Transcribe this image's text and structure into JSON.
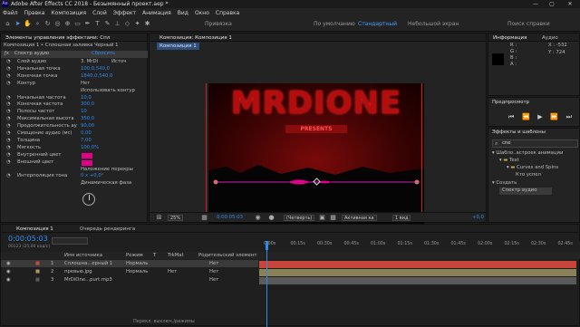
{
  "window": {
    "title": "Adobe After Effects CC 2018 - Безымянный проект.aep *",
    "app_icon": "Ae",
    "min": "—",
    "max": "▢",
    "close": "✕"
  },
  "menu": [
    "Файл",
    "Правка",
    "Композиция",
    "Слой",
    "Эффект",
    "Анимация",
    "Вид",
    "Окно",
    "Справка"
  ],
  "toolbar": {
    "snap": "Привязка",
    "ws_default": "По умолчанию",
    "ws_std": "Стандартный",
    "ws_small": "Небольшой экран",
    "search": "Поиск справки"
  },
  "effects_panel": {
    "tab_label": "Элементы управления эффектами: Спл",
    "layer_path": "Композиция 1 • Сплошная заливка Черный 1",
    "effect_name": "Спектр аудио",
    "reset": "Сбросить",
    "rows": [
      {
        "label": "Слой аудио",
        "value": "3. MrDi",
        "value2": "Источ"
      },
      {
        "label": "Начальная точка",
        "value": "100,0,540,0"
      },
      {
        "label": "Конечная точка",
        "value": "1840,0,540,0"
      },
      {
        "label": "Контур",
        "value": "Нет"
      },
      {
        "label": "",
        "value": "Использовать контур"
      },
      {
        "label": "Начальная частота",
        "value": "10,0"
      },
      {
        "label": "Конечная частота",
        "value": "300,0"
      },
      {
        "label": "Полосы частот",
        "value": "10"
      },
      {
        "label": "Максимальная высота",
        "value": "350,0"
      },
      {
        "label": "Продолжительность ау",
        "value": "90,00"
      },
      {
        "label": "Смещение аудио (мс)",
        "value": "0,00"
      },
      {
        "label": "Толщина",
        "value": "7,00"
      },
      {
        "label": "Мягкость",
        "value": "100,0%"
      },
      {
        "label": "Внутренний цвет",
        "value": ""
      },
      {
        "label": "Внешний цвет",
        "value": ""
      },
      {
        "label": "",
        "value": "Наложение перекры"
      },
      {
        "label": "Интерполяция тона",
        "value": "0 x +0,0°"
      },
      {
        "label": "",
        "value": "Динамическая фаза"
      }
    ]
  },
  "comp_panel": {
    "tab": "Композиция: Композиция 1",
    "subtab": "Композиция 1",
    "zoom": "25%",
    "time": "0:00:05:03",
    "quality": "(Четверть)",
    "camera": "Активная ка",
    "views": "1 вид",
    "offset": "+0,0"
  },
  "preview_text": {
    "title": "MRDIONE",
    "subtitle": "PRESENTS"
  },
  "info_panel": {
    "tab": "Информация",
    "tab2": "Аудио",
    "r": "R :",
    "g": "G :",
    "b": "B :",
    "a": "A :",
    "x": "X : -532",
    "y": "Y : 724"
  },
  "preview_panel": {
    "tab": "Предпросмотр"
  },
  "fx_presets": {
    "tab": "Эффекты и шаблоны",
    "search": "спе",
    "items": [
      "Шабло..астроек анимации",
      "Text",
      "Curves and Spins",
      "Кто успел",
      "Создать",
      "Спектр аудио"
    ]
  },
  "timeline": {
    "tab": "Композиция 1",
    "tab2": "Очередь рендеринга",
    "time": "0:00:05:03",
    "time_sub": "00123 (25,00 кад/с)",
    "headers": {
      "name": "Имя источника",
      "mode": "Режим",
      "t": "T",
      "trkmat": "TrkMat",
      "parent": "Родительский элемент"
    },
    "ticks": [
      "0:00s",
      "00:15s",
      "00:30s",
      "00:45s",
      "01:00s",
      "01:15s",
      "01:30s",
      "01:45s",
      "02:00s",
      "02:15s",
      "02:30s",
      "02:45s"
    ],
    "layers": [
      {
        "num": "1",
        "name": "Сплошна...ерный 1",
        "mode": "Нормаль",
        "trk": "",
        "parent": "Нет",
        "color": "#c8453c"
      },
      {
        "num": "2",
        "name": "превью.jpg",
        "mode": "Нормаль",
        "trk": "Нет",
        "parent": "Нет",
        "color": "#a89a62"
      },
      {
        "num": "3",
        "name": "MrDiOne...purt.mp3",
        "mode": "",
        "trk": "",
        "parent": "Нет",
        "color": "#5a5a5a"
      }
    ],
    "footer": "Перекл. выключ./режимы"
  },
  "colors": {
    "accent": "#2d8ceb",
    "red": "#c8453c",
    "magenta": "#e3008c"
  }
}
